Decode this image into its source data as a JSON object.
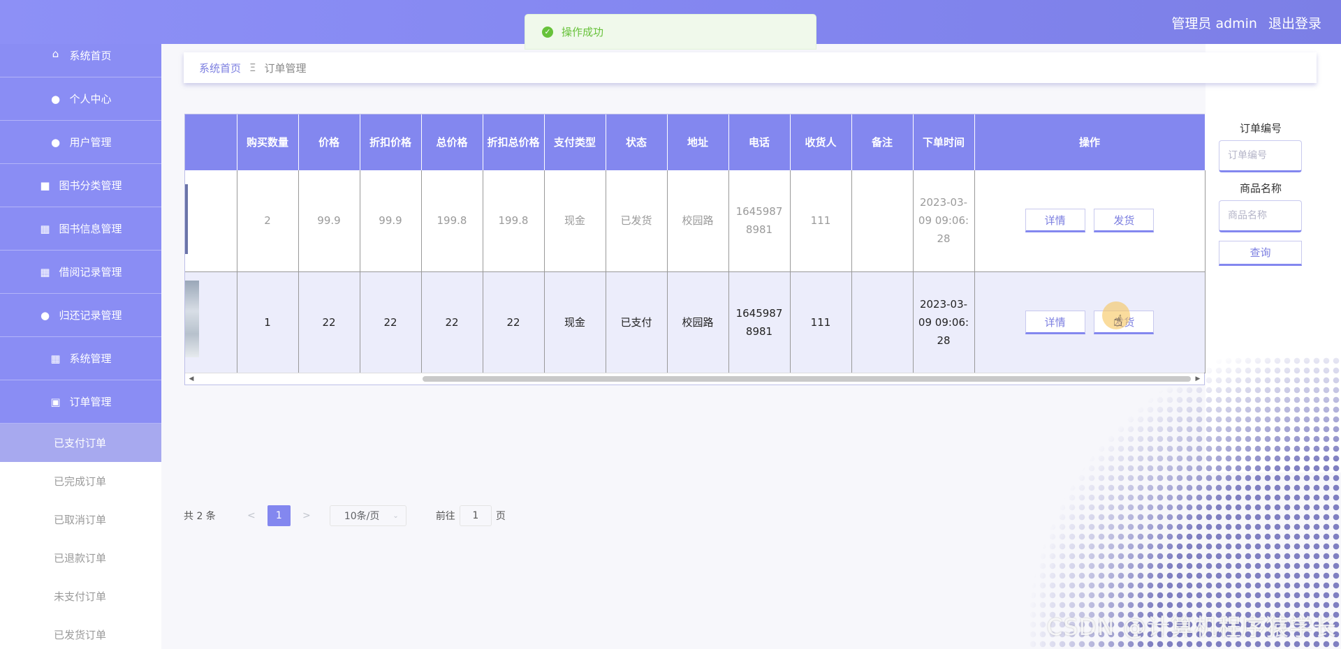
{
  "header": {
    "user_label": "管理员 admin",
    "logout": "退出登录"
  },
  "toast": {
    "message": "操作成功"
  },
  "sidebar": {
    "items": [
      {
        "label": "系统首页",
        "icon": "home-icon"
      },
      {
        "label": "个人中心",
        "icon": "user-icon"
      },
      {
        "label": "用户管理",
        "icon": "user-manage-icon"
      },
      {
        "label": "图书分类管理",
        "icon": "briefcase-icon"
      },
      {
        "label": "图书信息管理",
        "icon": "grid-icon"
      },
      {
        "label": "借阅记录管理",
        "icon": "grid-icon"
      },
      {
        "label": "归还记录管理",
        "icon": "bulb-icon"
      },
      {
        "label": "系统管理",
        "icon": "grid-icon"
      },
      {
        "label": "订单管理",
        "icon": "clipboard-icon"
      }
    ],
    "sub_items": [
      "已支付订单",
      "已完成订单",
      "已取消订单",
      "已退款订单",
      "未支付订单",
      "已发货订单"
    ],
    "active_sub": "已支付订单"
  },
  "breadcrumb": {
    "home": "系统首页",
    "sep": "Ξ",
    "current": "订单管理"
  },
  "table": {
    "headers": [
      "购买数量",
      "价格",
      "折扣价格",
      "总价格",
      "折扣总价格",
      "支付类型",
      "状态",
      "地址",
      "电话",
      "收货人",
      "备注",
      "下单时间",
      "操作"
    ],
    "rows": [
      {
        "qty": "2",
        "price": "99.9",
        "discount_price": "99.9",
        "total": "199.8",
        "discount_total": "199.8",
        "pay_type": "现金",
        "status": "已发货",
        "address": "校园路",
        "phone": "16459878981",
        "receiver": "111",
        "note": "",
        "time": "2023-03-09 09:06:28",
        "btn1": "详情",
        "btn2": "发货"
      },
      {
        "qty": "1",
        "price": "22",
        "discount_price": "22",
        "total": "22",
        "discount_total": "22",
        "pay_type": "现金",
        "status": "已支付",
        "address": "校园路",
        "phone": "16459878981",
        "receiver": "111",
        "note": "",
        "time": "2023-03-09 09:06:28",
        "btn1": "详情",
        "btn2": "发货"
      }
    ]
  },
  "search": {
    "order_no_label": "订单编号",
    "order_no_placeholder": "订单编号",
    "product_label": "商品名称",
    "product_placeholder": "商品名称",
    "query_button": "查询"
  },
  "pager": {
    "total": "共 2 条",
    "prev": "<",
    "current_page": "1",
    "next": ">",
    "page_size": "10条/页",
    "goto_label": "前往",
    "goto_value": "1",
    "page_suffix": "页"
  },
  "watermark": "CSDN @计算机程序猿学长"
}
